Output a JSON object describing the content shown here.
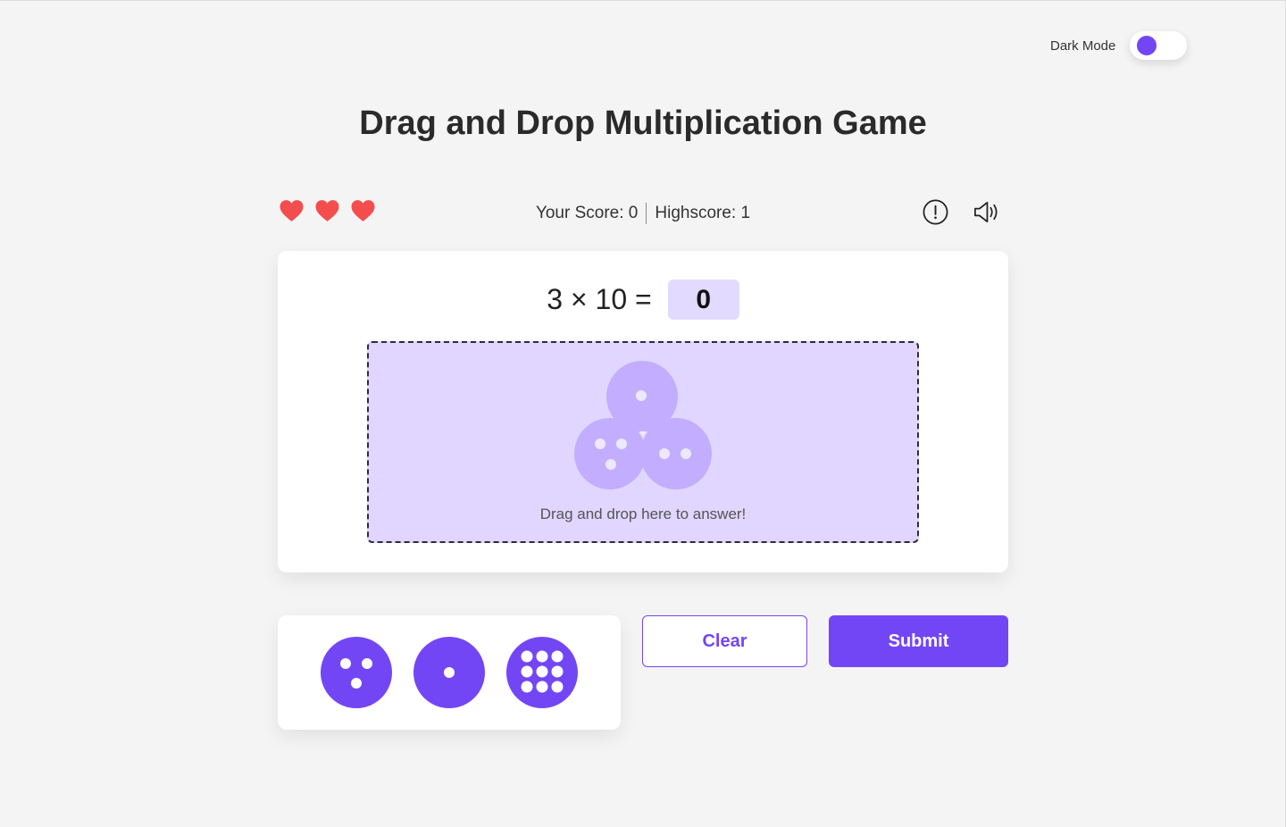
{
  "dark_mode": {
    "label": "Dark Mode",
    "enabled": false
  },
  "title": "Drag and Drop Multiplication Game",
  "lives": {
    "count": 3,
    "icon": "heart-icon",
    "color": "#f44d4d"
  },
  "score": {
    "current_label": "Your Score: 0",
    "high_label": "Highscore: 1"
  },
  "icons": {
    "info": "info-icon",
    "sound": "speaker-icon"
  },
  "question": {
    "text": "3 × 10 =",
    "answer": "0"
  },
  "drop_zone": {
    "hint": "Drag and drop here to answer!"
  },
  "dice": [
    {
      "value": 3,
      "icon": "die-three-icon"
    },
    {
      "value": 1,
      "icon": "die-one-icon"
    },
    {
      "value": 10,
      "icon": "die-ten-icon"
    }
  ],
  "buttons": {
    "clear": "Clear",
    "submit": "Submit"
  },
  "colors": {
    "accent": "#7346f5",
    "accent_light": "#e0d6ff",
    "drop_dice": "#c3adff",
    "heart": "#f44d4d",
    "background": "#f4f4f4"
  }
}
